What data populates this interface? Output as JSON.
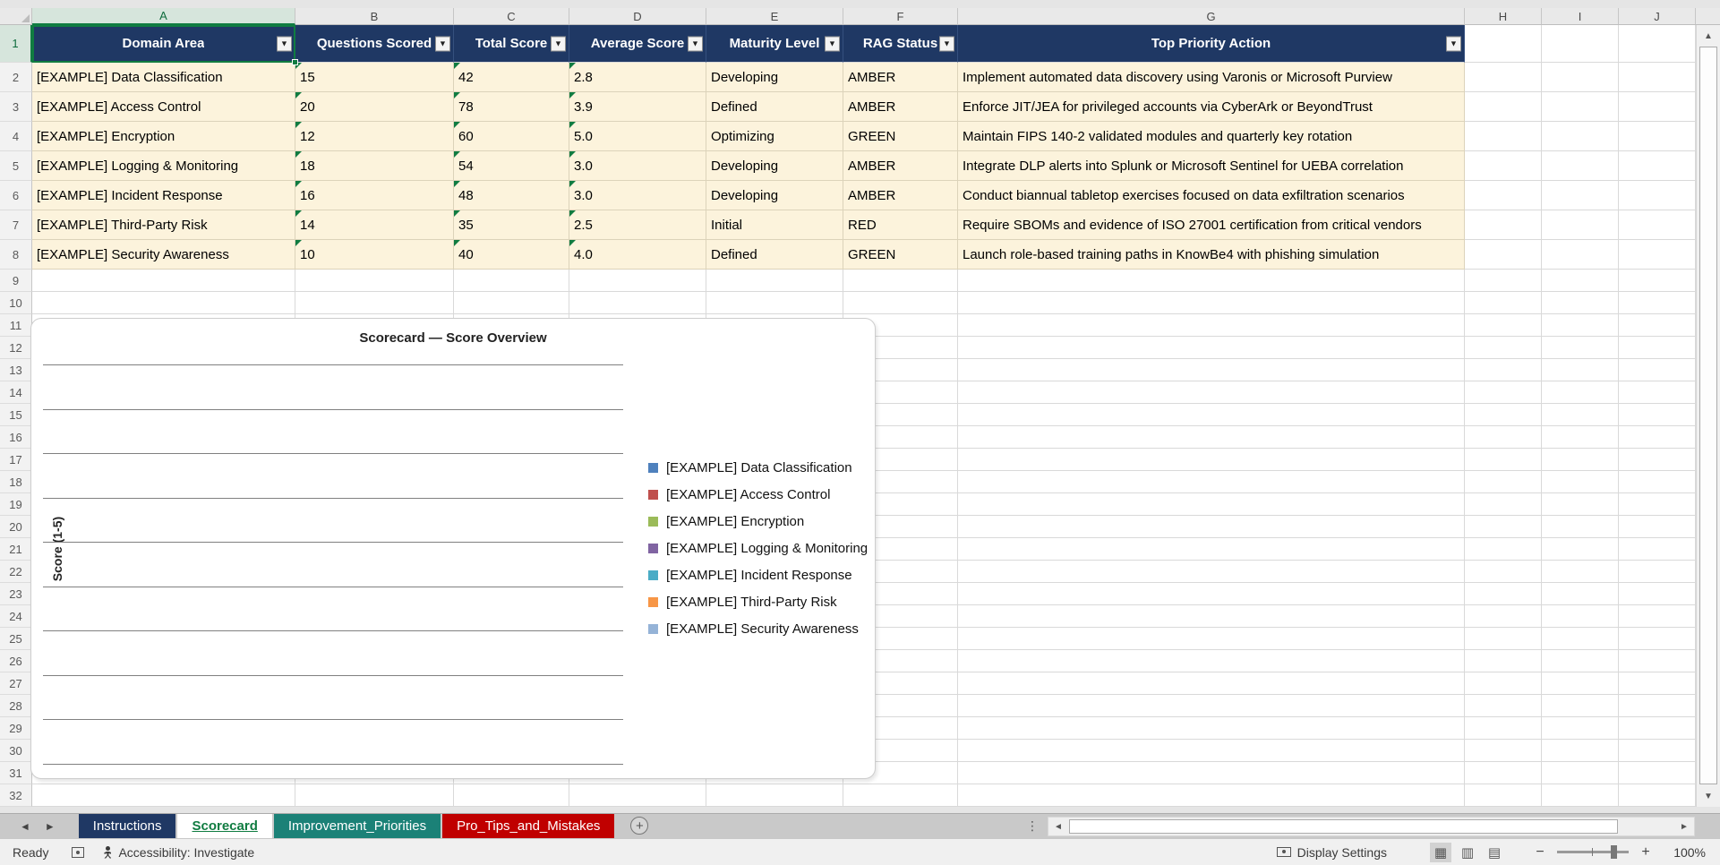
{
  "selection": {
    "cell": "A1",
    "column": "A",
    "row": 1
  },
  "columns": [
    "A",
    "B",
    "C",
    "D",
    "E",
    "F",
    "G",
    "H",
    "I",
    "J"
  ],
  "grid": {
    "visible_rows": 32
  },
  "table": {
    "headers": [
      "Domain Area",
      "Questions Scored",
      "Total Score",
      "Average Score",
      "Maturity Level",
      "RAG Status",
      "Top Priority Action"
    ],
    "rows": [
      [
        "[EXAMPLE] Data Classification",
        "15",
        "42",
        "2.8",
        "Developing",
        "AMBER",
        "Implement automated data discovery using Varonis or Microsoft Purview"
      ],
      [
        "[EXAMPLE] Access Control",
        "20",
        "78",
        "3.9",
        "Defined",
        "AMBER",
        "Enforce JIT/JEA for privileged accounts via CyberArk or BeyondTrust"
      ],
      [
        "[EXAMPLE] Encryption",
        "12",
        "60",
        "5.0",
        "Optimizing",
        "GREEN",
        "Maintain FIPS 140-2 validated modules and quarterly key rotation"
      ],
      [
        "[EXAMPLE] Logging & Monitoring",
        "18",
        "54",
        "3.0",
        "Developing",
        "AMBER",
        "Integrate DLP alerts into Splunk or Microsoft Sentinel for UEBA correlation"
      ],
      [
        "[EXAMPLE] Incident Response",
        "16",
        "48",
        "3.0",
        "Developing",
        "AMBER",
        "Conduct biannual tabletop exercises focused on data exfiltration scenarios"
      ],
      [
        "[EXAMPLE] Third-Party Risk",
        "14",
        "35",
        "2.5",
        "Initial",
        "RED",
        "Require SBOMs and evidence of ISO 27001 certification from critical vendors"
      ],
      [
        "[EXAMPLE] Security Awareness",
        "10",
        "40",
        "4.0",
        "Defined",
        "GREEN",
        "Launch role-based training paths in KnowBe4 with phishing simulation"
      ]
    ]
  },
  "chart_data": {
    "type": "bar",
    "title": "Scorecard — Score Overview",
    "ylabel": "Score (1-5)",
    "series": [
      {
        "name": "[EXAMPLE] Data Classification",
        "color": "#4F81BD"
      },
      {
        "name": "[EXAMPLE] Access Control",
        "color": "#C0504D"
      },
      {
        "name": "[EXAMPLE] Encryption",
        "color": "#9BBB59"
      },
      {
        "name": "[EXAMPLE] Logging & Monitoring",
        "color": "#8064A2"
      },
      {
        "name": "[EXAMPLE] Incident Response",
        "color": "#4BACC6"
      },
      {
        "name": "[EXAMPLE] Third-Party Risk",
        "color": "#F79646"
      },
      {
        "name": "[EXAMPLE] Security Awareness",
        "color": "#95B3D7"
      }
    ],
    "values_visible": false,
    "gridlines": 10,
    "legend_position": "right"
  },
  "sheet_tabs": [
    {
      "label": "Instructions",
      "bg": "#1F3864",
      "fg": "#FFFFFF",
      "active": false
    },
    {
      "label": "Scorecard",
      "bg": "#FFFFFF",
      "fg": "#107C41",
      "active": true
    },
    {
      "label": "Improvement_Priorities",
      "bg": "#1B8177",
      "fg": "#FFFFFF",
      "active": false
    },
    {
      "label": "Pro_Tips_and_Mistakes",
      "bg": "#C00000",
      "fg": "#FFFFFF",
      "active": false
    }
  ],
  "status_bar": {
    "ready": "Ready",
    "accessibility": "Accessibility: Investigate",
    "display_settings": "Display Settings",
    "zoom_out": "−",
    "zoom_in": "+",
    "zoom_level": "100%"
  },
  "icons": {
    "dropdown": "▼",
    "nav_left": "◄",
    "nav_right": "►",
    "add_sheet": "+",
    "splitter": "⋮",
    "scroll_up": "▲",
    "scroll_down": "▼",
    "scroll_left": "◄",
    "scroll_right": "►",
    "view_normal": "▦",
    "view_layout": "▥",
    "view_break": "▤"
  },
  "colors": {
    "header_fill": "#1F3864",
    "data_fill": "#FCF3DC",
    "selection_green": "#107C41"
  }
}
